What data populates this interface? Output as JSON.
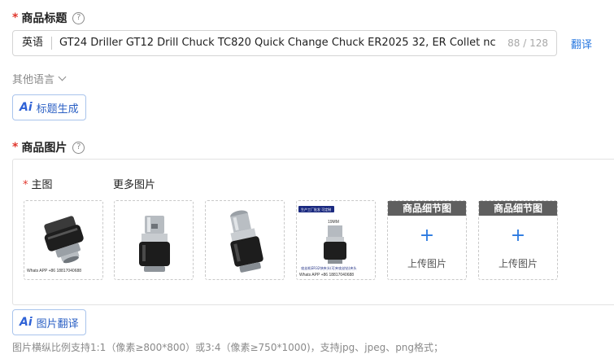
{
  "title_section": {
    "required_mark": "*",
    "label": "商品标题",
    "help_icon": "?",
    "language": "英语",
    "value": "GT24 Driller GT12 Drill Chuck TC820 Quick Change Chuck ER2025 32, ER Collet nc",
    "counter": "88 / 128",
    "translate_label": "翻译",
    "other_languages_label": "其他语言",
    "ai_icon": "Ai",
    "ai_button_label": "标题生成"
  },
  "images_section": {
    "required_mark": "*",
    "label": "商品图片",
    "help_icon": "?",
    "main_label": "主图",
    "more_label": "更多图片",
    "main_image_caption": "Whats APP +86 18817040688",
    "image4_banner": "生产工厂批发 可定制",
    "image4_size": "19MM",
    "image4_text": "攻丝机ER32快夹头(可夹攻丝钻)夹头",
    "image4_caption": "Whats APP +86 18817040688",
    "slots": [
      {
        "header": "商品细节图",
        "plus": "+",
        "upload_label": "上传图片"
      },
      {
        "header": "商品细节图",
        "plus": "+",
        "upload_label": "上传图片"
      }
    ],
    "ai_icon": "Ai",
    "ai_button_label": "图片翻译",
    "hint": "图片横纵比例支持1:1（像素≥800*800）或3:4（像素≥750*1000)，支持jpg、jpeg、png格式；"
  }
}
